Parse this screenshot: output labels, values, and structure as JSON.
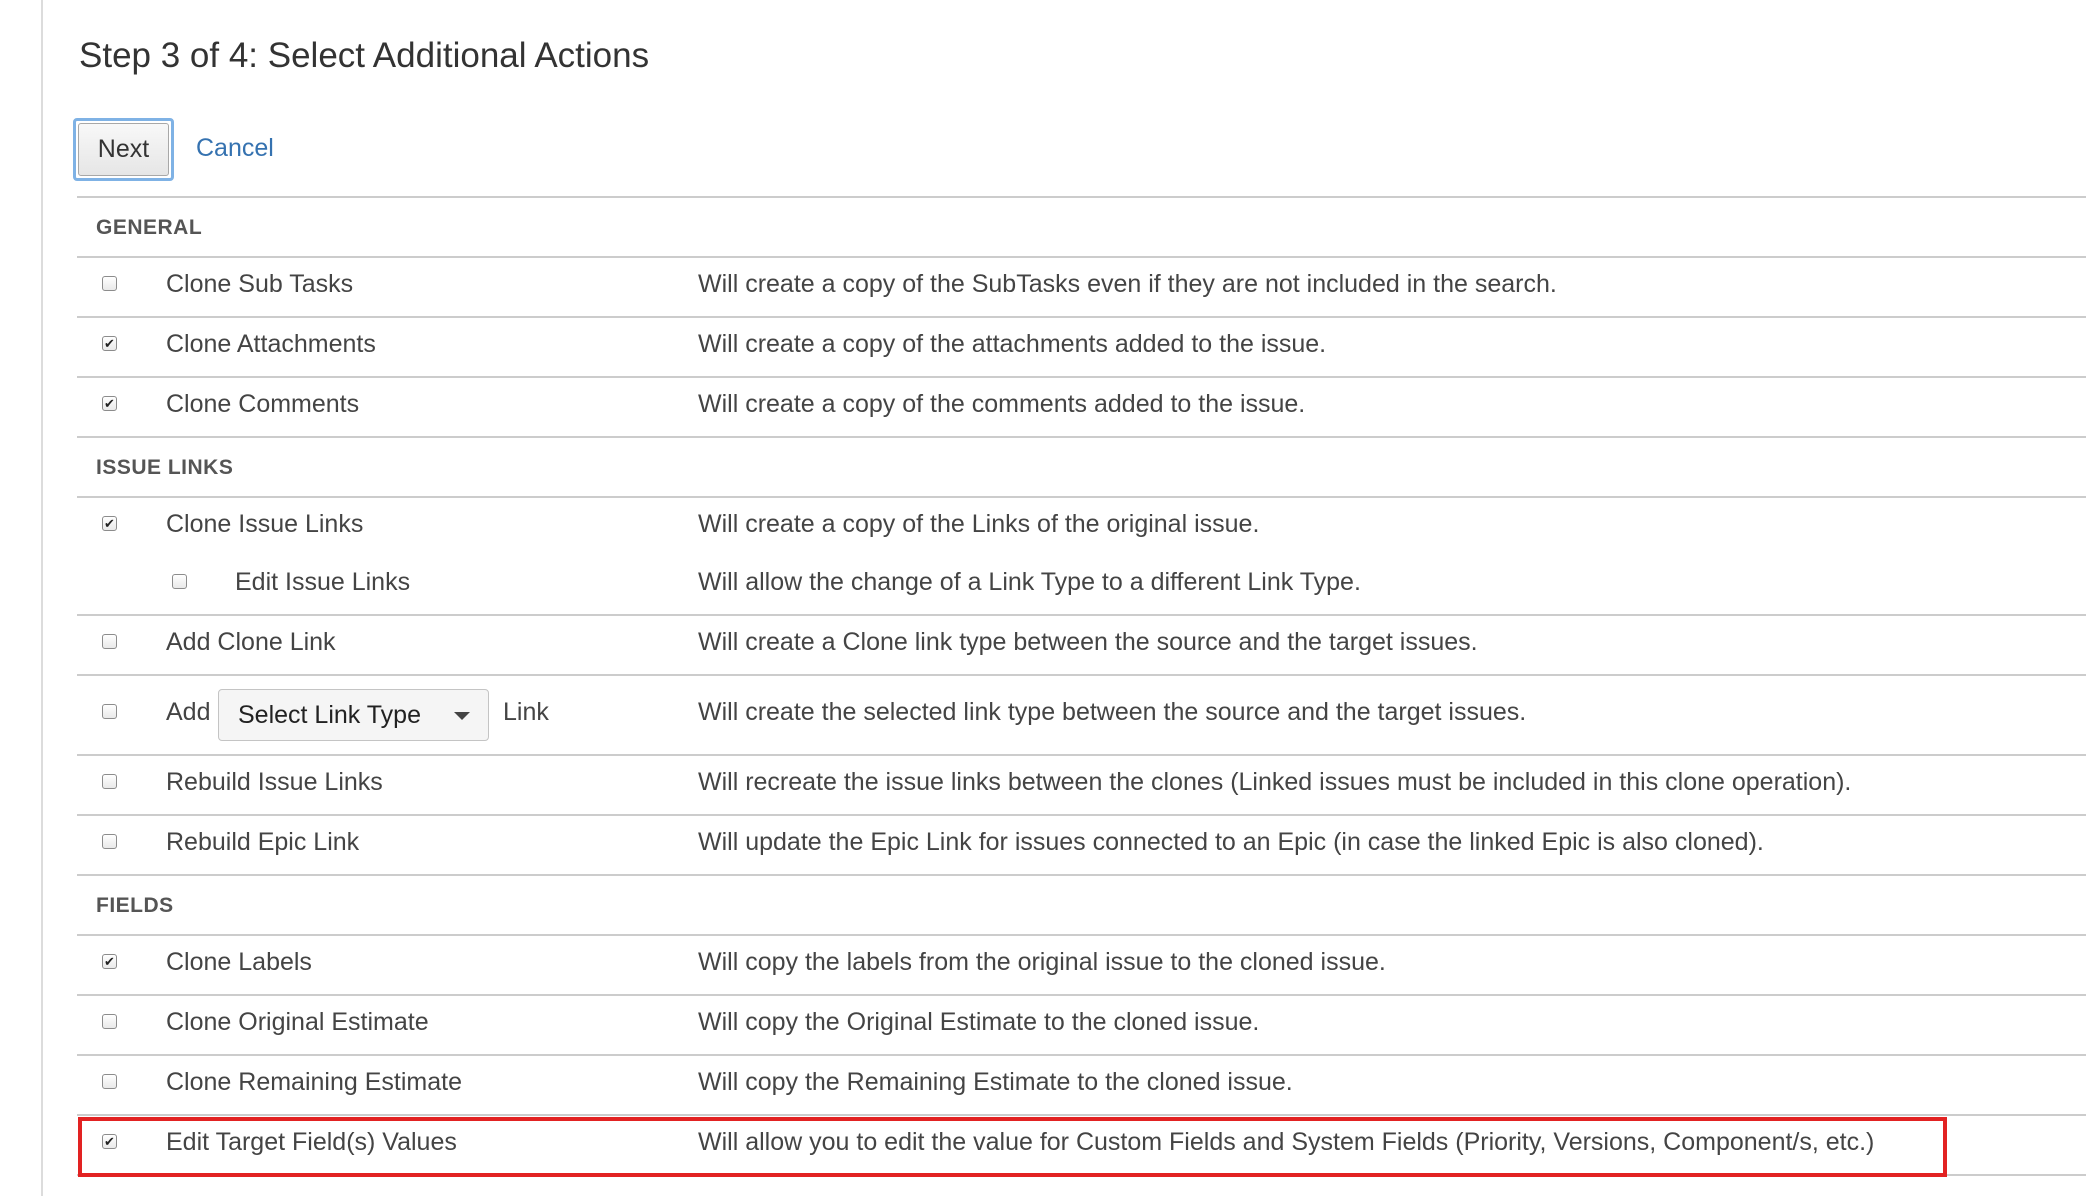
{
  "page": {
    "title": "Step 3 of 4: Select Additional Actions",
    "next_label": "Next",
    "cancel_label": "Cancel"
  },
  "sections": {
    "general": "GENERAL",
    "issue_links": "ISSUE LINKS",
    "fields": "FIELDS"
  },
  "options": {
    "clone_sub_tasks": {
      "label": "Clone Sub Tasks",
      "desc": "Will create a copy of the SubTasks even if they are not included in the search.",
      "checked": false
    },
    "clone_attachments": {
      "label": "Clone Attachments",
      "desc": "Will create a copy of the attachments added to the issue.",
      "checked": true
    },
    "clone_comments": {
      "label": "Clone Comments",
      "desc": "Will create a copy of the comments added to the issue.",
      "checked": true
    },
    "clone_issue_links": {
      "label": "Clone Issue Links",
      "desc": "Will create a copy of the Links of the original issue.",
      "checked": true
    },
    "edit_issue_links": {
      "label": "Edit Issue Links",
      "desc": "Will allow the change of a Link Type to a different Link Type.",
      "checked": false
    },
    "add_clone_link": {
      "label": "Add Clone Link",
      "desc": "Will create a Clone link type between the source and the target issues.",
      "checked": false
    },
    "add_link": {
      "prefix": "Add",
      "select_value": "Select Link Type",
      "suffix": "Link",
      "desc": "Will create the selected link type between the source and the target issues.",
      "checked": false
    },
    "rebuild_issue_links": {
      "label": "Rebuild Issue Links",
      "desc": "Will recreate the issue links between the clones (Linked issues must be included in this clone operation).",
      "checked": false
    },
    "rebuild_epic_link": {
      "label": "Rebuild Epic Link",
      "desc": "Will update the Epic Link for issues connected to an Epic (in case the linked Epic is also cloned).",
      "checked": false
    },
    "clone_labels": {
      "label": "Clone Labels",
      "desc": "Will copy the labels from the original issue to the cloned issue.",
      "checked": true
    },
    "clone_original_estimate": {
      "label": "Clone Original Estimate",
      "desc": "Will copy the Original Estimate to the cloned issue.",
      "checked": false
    },
    "clone_remaining_estimate": {
      "label": "Clone Remaining Estimate",
      "desc": "Will copy the Remaining Estimate to the cloned issue.",
      "checked": false
    },
    "edit_target_fields": {
      "label": "Edit Target Field(s) Values",
      "desc": "Will allow you to edit the value for Custom Fields and System Fields (Priority, Versions, Component/s, etc.)",
      "checked": true
    }
  },
  "colors": {
    "link": "#3572b0",
    "highlight": "#e22222",
    "focus_ring": "#7fb2e5"
  }
}
